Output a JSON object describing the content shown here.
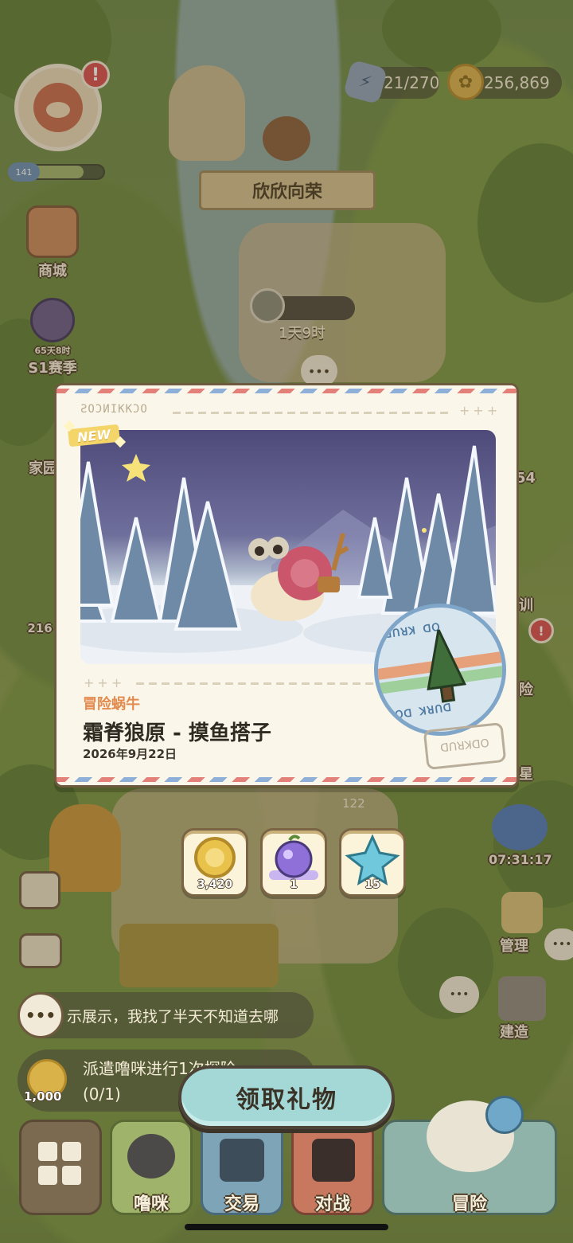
{
  "hud": {
    "level": "141",
    "level_progress": 0.78,
    "alert_badge": "!",
    "energy": "21/270",
    "coins": "256,869",
    "banner_title": "欣欣向荣",
    "timer": "1天9时",
    "chat_bubble": "•••"
  },
  "left_menu": [
    {
      "label": "商城"
    },
    {
      "label": "S1赛季",
      "sub": "65天8时"
    },
    {
      "label": "家园"
    },
    {
      "label": "216"
    }
  ],
  "right_menu": [
    {
      "label": "54"
    },
    {
      "label": "训"
    },
    {
      "label": "险"
    },
    {
      "label": "星"
    },
    {
      "label": "07:31:17"
    },
    {
      "label": "管理"
    },
    {
      "label": "建造"
    }
  ],
  "world_counts": {
    "stall_count": "122"
  },
  "card": {
    "stamp_code": "ƧOƆИIKKƆO",
    "new_tag": "NEW",
    "category": "冒险蜗牛",
    "title": "霜脊狼原 - 摸鱼搭子",
    "date": "2026年9月22日",
    "postmark_top": "ꓷꓵꓤꓘ ꓷꓳ",
    "postmark_bottom": "ꓳꓷ ꓘꓤꓵꓷ",
    "stamp2_text": "ꓷꓵꓤꓘꓷꓳ"
  },
  "rewards": [
    {
      "name": "coin",
      "qty": "3,420",
      "color": "#e8c24a"
    },
    {
      "name": "fruit",
      "qty": "1",
      "color": "#8f6fd8"
    },
    {
      "name": "crystal",
      "qty": "15",
      "color": "#6fc8dc"
    }
  ],
  "chat": {
    "text": "示展示，我找了半天不知道去哪"
  },
  "task": {
    "text_line1": "派遣噜咪进行1次探险",
    "text_line2": "(0/1)",
    "reward": "1,000"
  },
  "claim_button": "领取礼物",
  "nav": {
    "lumi": "噜咪",
    "trade": "交易",
    "battle": "对战",
    "adventure": "冒险"
  },
  "colors": {
    "card_bg": "#fbf6ea",
    "accent_orange": "#e38b4e",
    "claim_button": "#a3d8d6"
  }
}
